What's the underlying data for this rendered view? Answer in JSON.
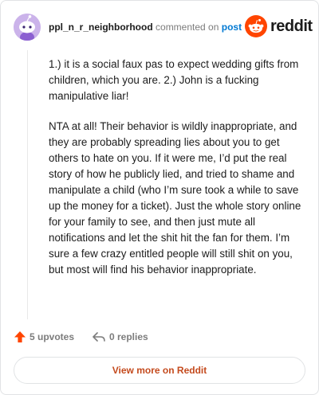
{
  "comment": {
    "username": "ppl_n_r_neighborhood",
    "action_text": "commented on",
    "post_link_text": "post",
    "logo_text": "reddit",
    "paragraphs": [
      "1.) it is a social faux pas to expect wedding gifts from children, which you are. 2.) John is a fucking manipulative liar!",
      "NTA at all! Their behavior is wildly inappropriate, and they are probably spreading lies about you to get others to hate on you. If it were me, I’d put the real story of how he publicly lied, and tried to shame and manipulate a child (who I’m sure took a while to save up the money for a ticket). Just the whole story online for your family to see, and then just mute all notifications and let the shit hit the fan for them. I’m sure a few crazy entitled people will still shit on you, but most will find his behavior inappropriate."
    ],
    "upvotes_label": "5 upvotes",
    "replies_label": "0 replies",
    "view_more_label": "View more on Reddit"
  },
  "colors": {
    "accent_orange": "#ff4500",
    "link_blue": "#0079d3",
    "avatar_bg": "#cbb3ea"
  },
  "icons": [
    "avatar-snoo-icon",
    "reddit-logo-icon",
    "upvote-arrow-icon",
    "reply-arrow-icon"
  ]
}
